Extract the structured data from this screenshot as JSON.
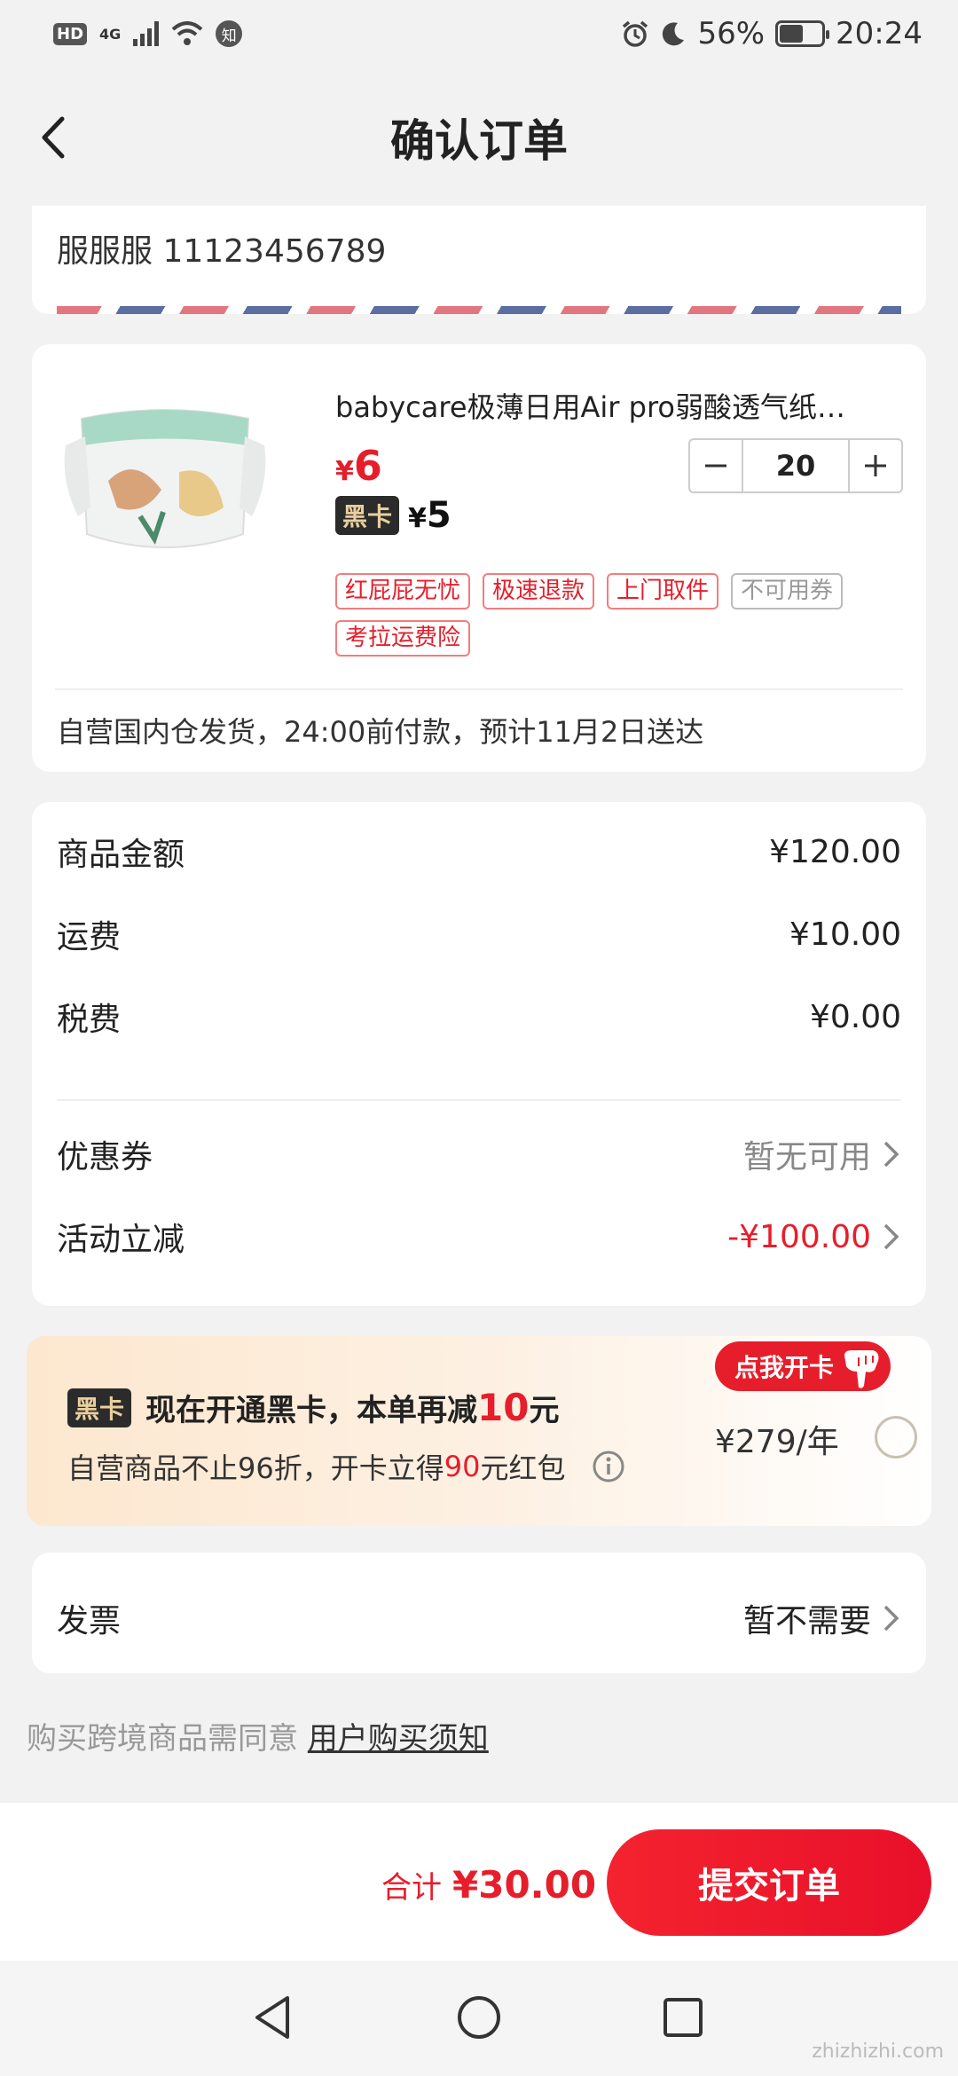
{
  "status_bar": {
    "hd": "HD",
    "signal": "4G",
    "zhi": "知",
    "battery_percent": "56%",
    "battery_level": 0.56,
    "time": "20:24"
  },
  "header": {
    "title": "确认订单"
  },
  "address": {
    "name_phone": "服服服 11123456789"
  },
  "product": {
    "title": "babycare极薄日用Air pro弱酸透气纸…",
    "price_symbol": "¥",
    "price": "6",
    "black_card_label": "黑卡",
    "black_card_price_symbol": "¥",
    "black_card_price": "5",
    "quantity": "20",
    "tags": [
      "红屁屁无忧",
      "极速退款",
      "上门取件",
      "不可用券",
      "考拉运费险"
    ],
    "shipping_note": "自营国内仓发货，24:00前付款，预计11月2日送达"
  },
  "summary": {
    "goods_label": "商品金额",
    "goods_value": "¥120.00",
    "freight_label": "运费",
    "freight_value": "¥10.00",
    "tax_label": "税费",
    "tax_value": "¥0.00",
    "coupon_label": "优惠券",
    "coupon_value": "暂无可用",
    "discount_label": "活动立减",
    "discount_value": "-¥100.00"
  },
  "promo": {
    "badge": "黑卡",
    "main_before": "现在开通黑卡，本单再减",
    "main_highlight": "10",
    "main_after": "元",
    "sub_before": "自营商品不止96折，开卡立得",
    "sub_highlight": "90",
    "sub_after": "元红包",
    "flag": "点我开卡",
    "price": "¥279/年"
  },
  "invoice": {
    "label": "发票",
    "value": "暂不需要"
  },
  "notice": {
    "text": "购买跨境商品需同意",
    "link": "用户购买须知"
  },
  "footer": {
    "total_label": "合计",
    "total_value": "¥30.00",
    "submit_label": "提交订单"
  },
  "watermark": "zhizhizhi.com",
  "colors": {
    "accent": "#e61e2b",
    "black_card_gold": "#e8cf9e",
    "promo_bg": "#fde7cf"
  }
}
